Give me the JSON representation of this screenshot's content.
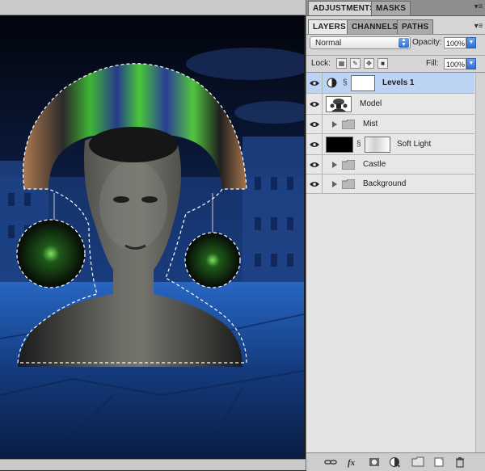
{
  "panel_tabs": [
    "ADJUSTMENTS",
    "MASKS"
  ],
  "layer_tabs": [
    "LAYERS",
    "CHANNELS",
    "PATHS"
  ],
  "blend_mode": "Normal",
  "opacity": {
    "label": "Opacity:",
    "value": "100%"
  },
  "lock": {
    "label": "Lock:"
  },
  "fill": {
    "label": "Fill:",
    "value": "100%"
  },
  "layers": [
    {
      "name": "Levels 1",
      "type": "adjustment",
      "selected": true,
      "visible": true
    },
    {
      "name": "Model",
      "type": "image",
      "selected": false,
      "visible": true
    },
    {
      "name": "Mist",
      "type": "group",
      "selected": false,
      "visible": true
    },
    {
      "name": "Soft Light",
      "type": "image-masked",
      "selected": false,
      "visible": true
    },
    {
      "name": "Castle",
      "type": "group",
      "selected": false,
      "visible": true
    },
    {
      "name": "Background",
      "type": "group",
      "selected": false,
      "visible": true
    }
  ],
  "bottom_icons": [
    "link-icon",
    "fx-icon",
    "mask-icon",
    "adjustment-icon",
    "folder-icon",
    "new-layer-icon",
    "trash-icon"
  ],
  "colors": {
    "selected_row": "#bcd3f3",
    "accent": "#2f6fd4"
  }
}
